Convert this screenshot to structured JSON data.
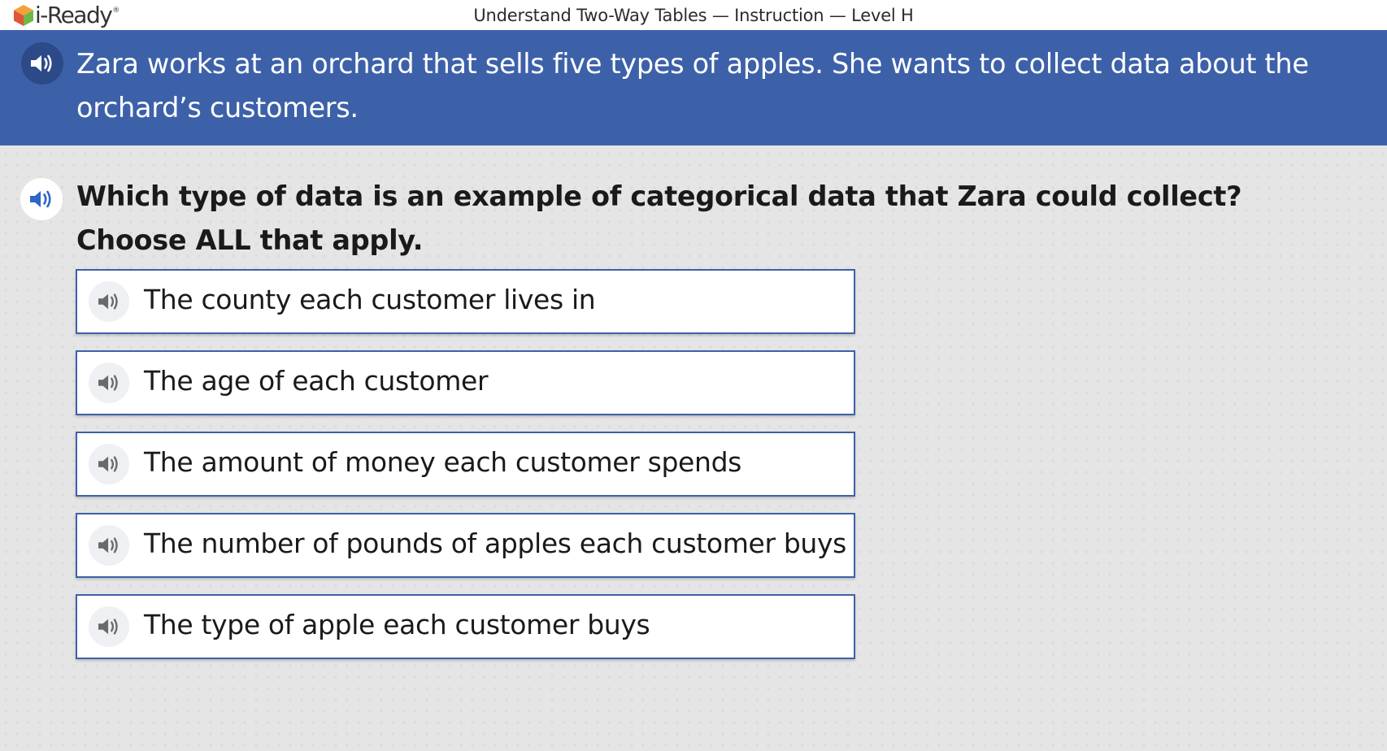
{
  "app": {
    "logo_text": "i-Ready",
    "logo_tm": "®",
    "lesson_title": "Understand Two-Way Tables — Instruction — Level H"
  },
  "prompt": {
    "text": "Zara works at an orchard that sells five types of apples. She wants to collect data about the orchard’s customers.",
    "audio_icon": "speaker-icon"
  },
  "question": {
    "line1": "Which type of data is an example of categorical data that Zara could collect?",
    "line2": "Choose ALL that apply.",
    "audio_icon": "speaker-icon"
  },
  "choices": [
    {
      "label": "The county each customer lives in",
      "selected": false
    },
    {
      "label": "The age of each customer",
      "selected": false
    },
    {
      "label": "The amount of money each customer spends",
      "selected": false
    },
    {
      "label": "The number of pounds of apples each customer buys",
      "selected": false
    },
    {
      "label": "The type of apple each customer buys",
      "selected": false
    }
  ],
  "colors": {
    "banner": "#3d61a9",
    "banner_audio": "#2b4a87",
    "question_audio_icon": "#2d66c9",
    "choice_border": "#3d61a9",
    "choice_audio_icon": "#6a6a6a",
    "background": "#e5e5e5"
  }
}
